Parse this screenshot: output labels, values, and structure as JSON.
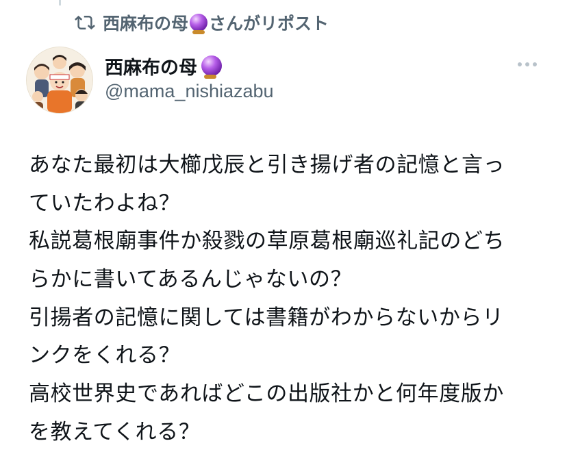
{
  "repost": {
    "icon": "repost-icon",
    "name": "西麻布の母",
    "suffix": "さんがリポスト"
  },
  "author": {
    "avatar_icon": "avatar-illustration",
    "display_name": "西麻布の母",
    "badge_icon": "crystal-ball-icon",
    "handle": "@mama_nishiazabu"
  },
  "menu": {
    "icon": "more-icon"
  },
  "tweet": {
    "lines": [
      "あなた最初は大櫛戊辰と引き揚げ者の記憶と言っ",
      "ていたわよね？",
      "私説葛根廟事件か殺戮の草原葛根廟巡礼記のどち",
      "らかに書いてあるんじゃないの？",
      "引揚者の記憶に関しては書籍がわからないからリ",
      "ンクをくれる？",
      "高校世界史であればどこの出版社かと何年度版か",
      "を教えてくれる？"
    ]
  },
  "colors": {
    "text": "#0f1419",
    "secondary": "#536471",
    "divider": "#cfd9de"
  }
}
